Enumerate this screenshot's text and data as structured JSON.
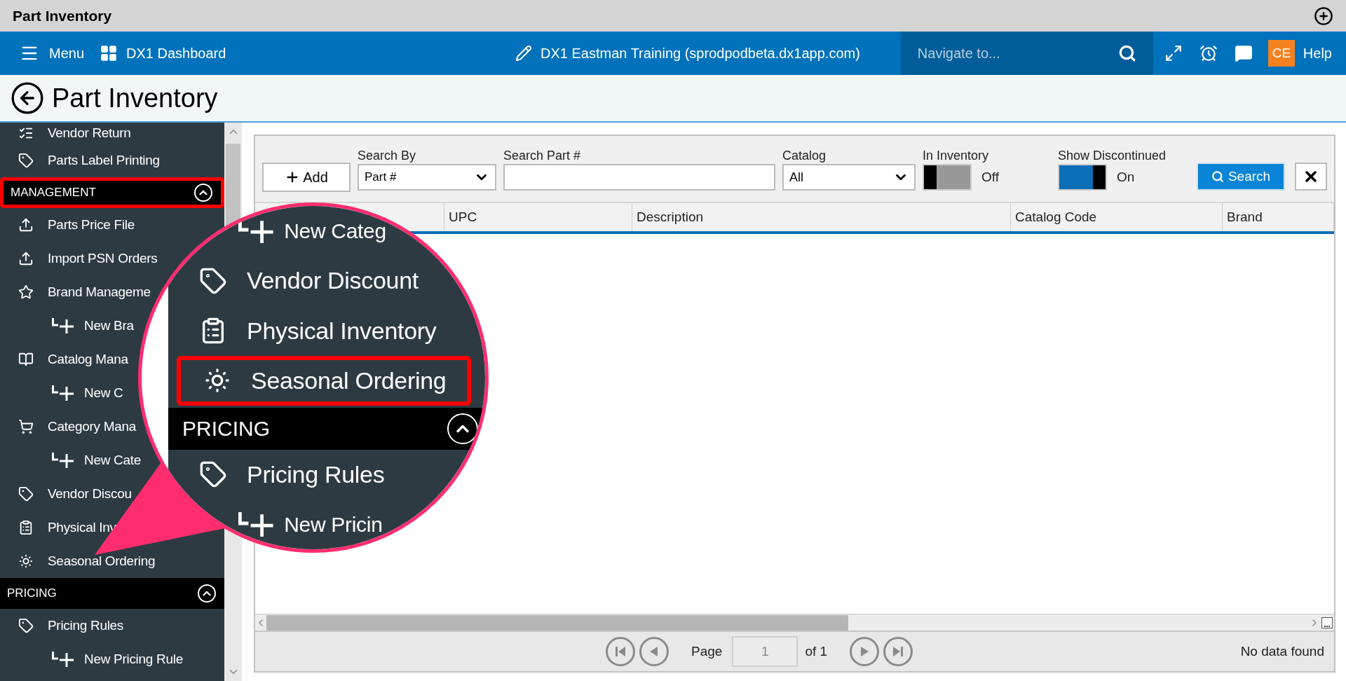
{
  "title_bar": {
    "title": "Part Inventory"
  },
  "nav": {
    "menu": "Menu",
    "dashboard": "DX1 Dashboard",
    "site": "DX1 Eastman Training (sprodpodbeta.dx1app.com)",
    "search": {
      "placeholder": "Navigate to..."
    },
    "user_initials": "CE",
    "help": "Help"
  },
  "page_header": {
    "title": "Part Inventory"
  },
  "sidebar": {
    "items": [
      {
        "kind": "item",
        "label": "Vendor Return"
      },
      {
        "kind": "item",
        "label": "Parts Label Printing"
      },
      {
        "kind": "header",
        "label": "MANAGEMENT",
        "expanded": true,
        "highlighted": true
      },
      {
        "kind": "item",
        "label": "Parts Price File"
      },
      {
        "kind": "item",
        "label": "Import PSN Orders"
      },
      {
        "kind": "item",
        "label": "Brand Manageme"
      },
      {
        "kind": "subitem",
        "label": "New Bra"
      },
      {
        "kind": "item",
        "label": "Catalog Mana"
      },
      {
        "kind": "subitem",
        "label": "New C"
      },
      {
        "kind": "item",
        "label": "Category Mana"
      },
      {
        "kind": "subitem",
        "label": "New Cate"
      },
      {
        "kind": "item",
        "label": "Vendor Discou"
      },
      {
        "kind": "item",
        "label": "Physical Inv"
      },
      {
        "kind": "item",
        "label": "Seasonal Ordering"
      },
      {
        "kind": "header",
        "label": "PRICING",
        "expanded": true,
        "highlighted": false
      },
      {
        "kind": "item",
        "label": "Pricing Rules"
      },
      {
        "kind": "subitem",
        "label": "New Pricing Rule"
      }
    ]
  },
  "toolbar": {
    "add": "Add",
    "search_by": {
      "label": "Search By",
      "value": "Part #"
    },
    "search_part": {
      "label": "Search Part #"
    },
    "catalog": {
      "label": "Catalog",
      "value": "All"
    },
    "in_inventory": {
      "label": "In Inventory",
      "on": false,
      "state_text": "Off"
    },
    "show_discontinued": {
      "label": "Show Discontinued",
      "on": true,
      "state_text": "On"
    },
    "search": "Search"
  },
  "table": {
    "columns": [
      "UPC",
      "Description",
      "Catalog Code",
      "Brand"
    ]
  },
  "pager": {
    "page_label": "Page",
    "page": "1",
    "of": "of 1",
    "status": "No data found"
  },
  "magnifier": {
    "items": [
      {
        "kind": "subitem",
        "label": "New Categ"
      },
      {
        "kind": "item",
        "label": "Vendor Discount",
        "highlighted": false
      },
      {
        "kind": "item",
        "label": "Physical Inventory",
        "highlighted": false
      },
      {
        "kind": "item",
        "label": "Seasonal Ordering",
        "highlighted": true
      },
      {
        "kind": "header",
        "label": "PRICING",
        "expanded": true
      },
      {
        "kind": "item",
        "label": "Pricing Rules",
        "highlighted": false
      },
      {
        "kind": "subitem",
        "label": "New Pricin"
      }
    ]
  }
}
